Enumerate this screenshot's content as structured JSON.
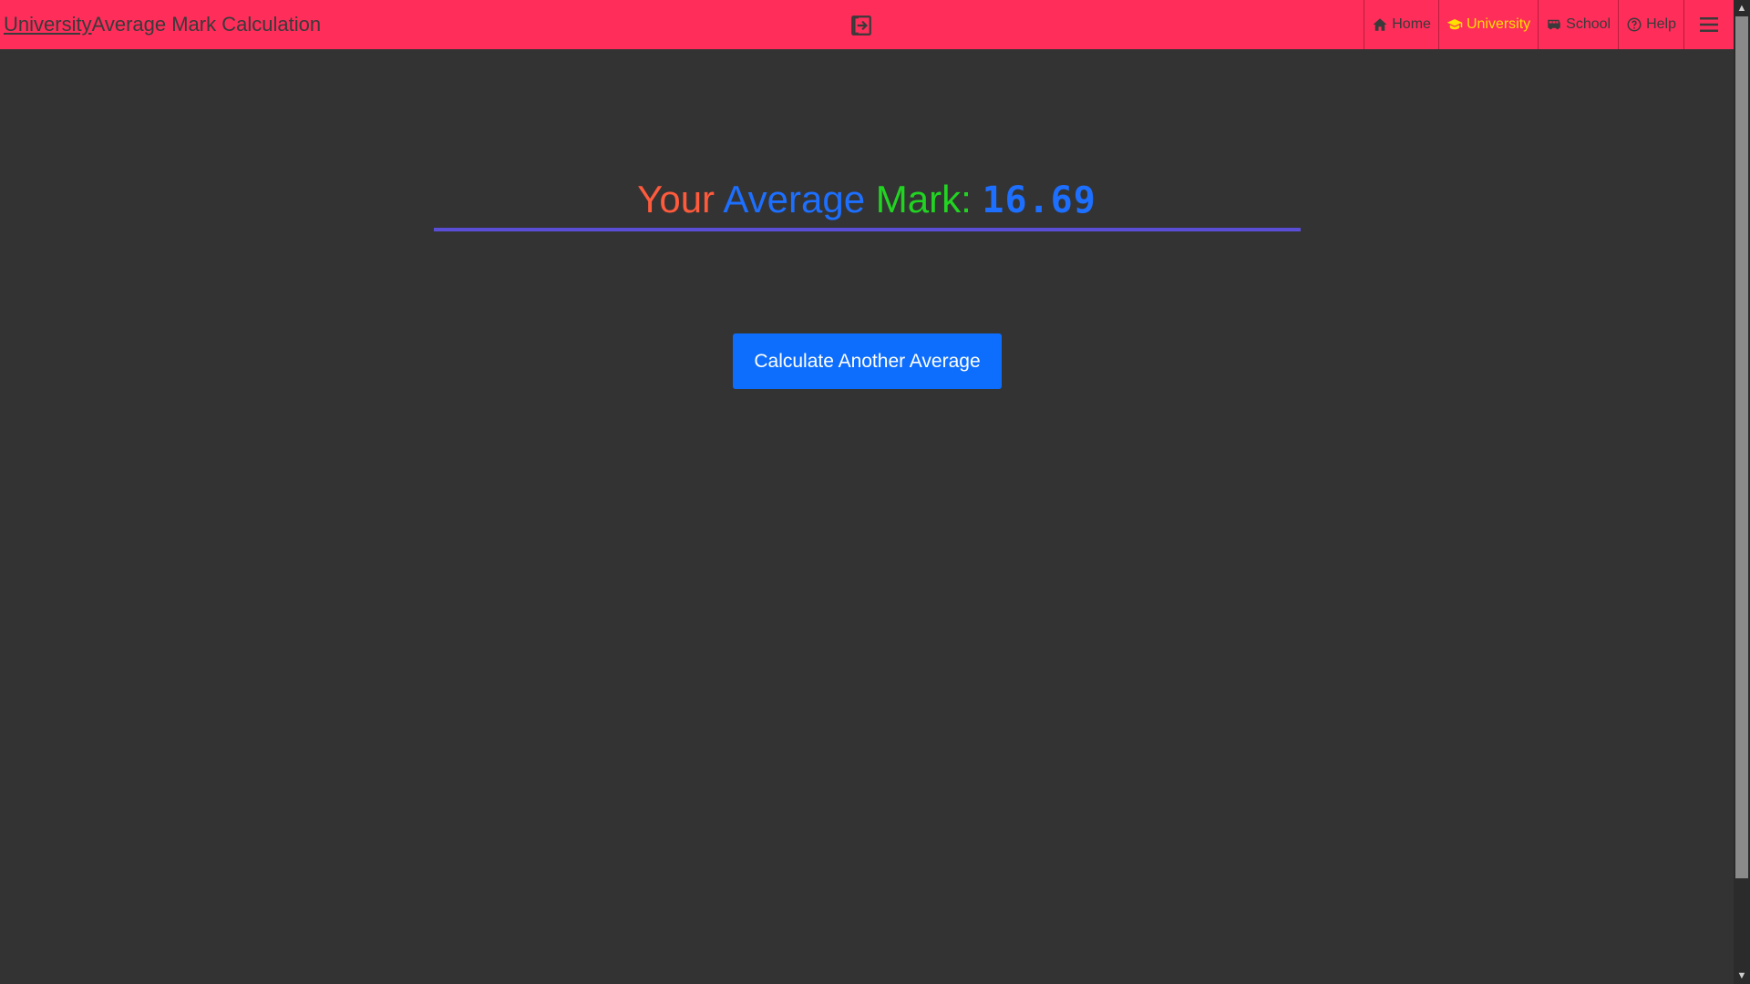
{
  "header": {
    "brand_link": "University",
    "brand_rest": " Average Mark Calculation",
    "accent_color": "#ff2d5a",
    "active_color": "#ffe000",
    "exit_icon": "exit-icon"
  },
  "nav": {
    "items": [
      {
        "label": "Home",
        "icon": "home-icon"
      },
      {
        "label": "University",
        "icon": "graduation-cap-icon",
        "active": true
      },
      {
        "label": "School",
        "icon": "school-bus-icon"
      },
      {
        "label": "Help",
        "icon": "question-circle-icon"
      }
    ],
    "menu_icon": "hamburger-menu-icon"
  },
  "result": {
    "word1": "Your ",
    "word2": "Average ",
    "word3": "Mark: ",
    "value": "16.69"
  },
  "actions": {
    "calculate_another": "Calculate Another Average"
  }
}
